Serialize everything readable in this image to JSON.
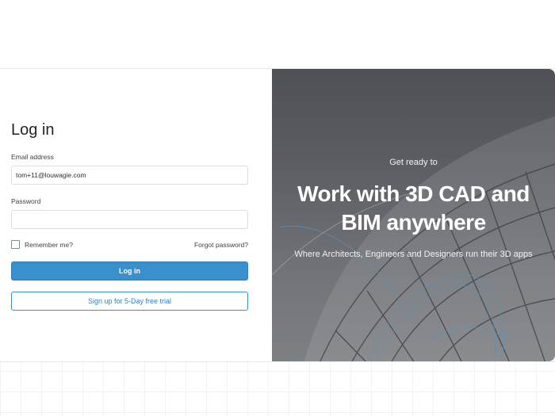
{
  "login": {
    "title": "Log in",
    "email_label": "Email address",
    "email_value": "tom+11@louwagie.com",
    "password_label": "Password",
    "password_value": "",
    "remember_label": "Remember me?",
    "forgot_label": "Forgot password?",
    "login_button": "Log in",
    "signup_button": "Sign up for 5-Day free trial"
  },
  "hero": {
    "eyebrow": "Get ready to",
    "headline": "Work with 3D CAD and BIM anywhere",
    "subtext": "Where Architects, Engineers and Designers run their 3D apps"
  },
  "colors": {
    "primary": "#3a8fcd",
    "text": "#1f2328",
    "hero_bg": "#6e7075"
  }
}
